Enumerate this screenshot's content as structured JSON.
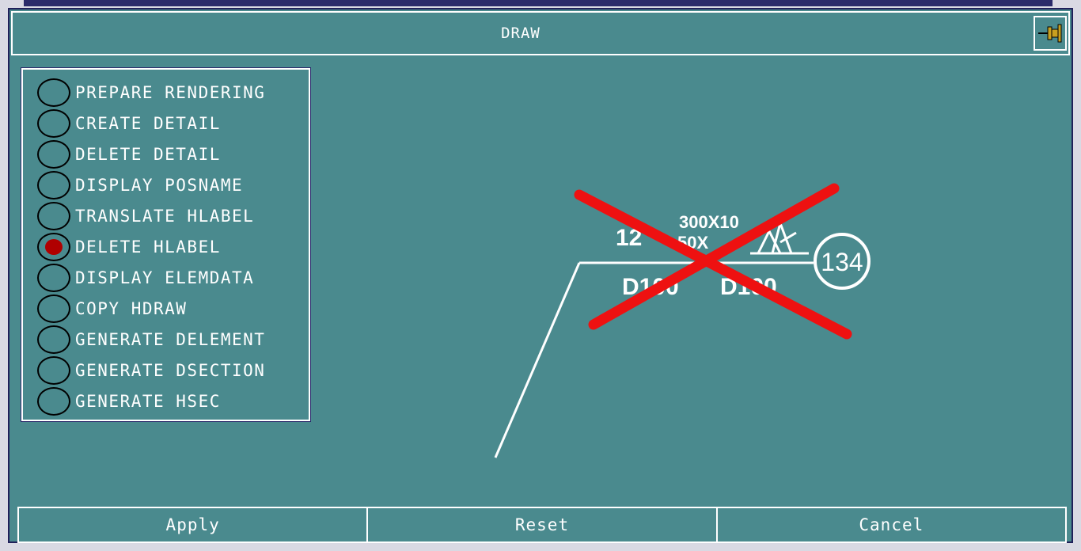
{
  "window": {
    "title": "DRAW",
    "pin_icon": "pin-icon"
  },
  "options": [
    {
      "label": "PREPARE RENDERING",
      "selected": false
    },
    {
      "label": "CREATE DETAIL",
      "selected": false
    },
    {
      "label": "DELETE DETAIL",
      "selected": false
    },
    {
      "label": "DISPLAY POSNAME",
      "selected": false
    },
    {
      "label": "TRANSLATE HLABEL",
      "selected": false
    },
    {
      "label": "DELETE HLABEL",
      "selected": true
    },
    {
      "label": "DISPLAY ELEMDATA",
      "selected": false
    },
    {
      "label": "COPY HDRAW",
      "selected": false
    },
    {
      "label": "GENERATE DELEMENT",
      "selected": false
    },
    {
      "label": "GENERATE DSECTION",
      "selected": false
    },
    {
      "label": "GENERATE HSEC",
      "selected": false
    }
  ],
  "preview": {
    "dimension_text": "300X10",
    "secondary_text": "50X",
    "left_label": "12",
    "tag_left": "D100",
    "tag_right": "D100",
    "circle_number": "134",
    "cross_icon": "red-x-icon",
    "colors": {
      "cross": "#ee1111",
      "lines": "#ffffff"
    }
  },
  "actions": {
    "apply": "Apply",
    "reset": "Reset",
    "cancel": "Cancel"
  },
  "colors": {
    "background": "#4a8a8e",
    "frame": "#d9d9e3",
    "selected_dot": "#b00000"
  }
}
